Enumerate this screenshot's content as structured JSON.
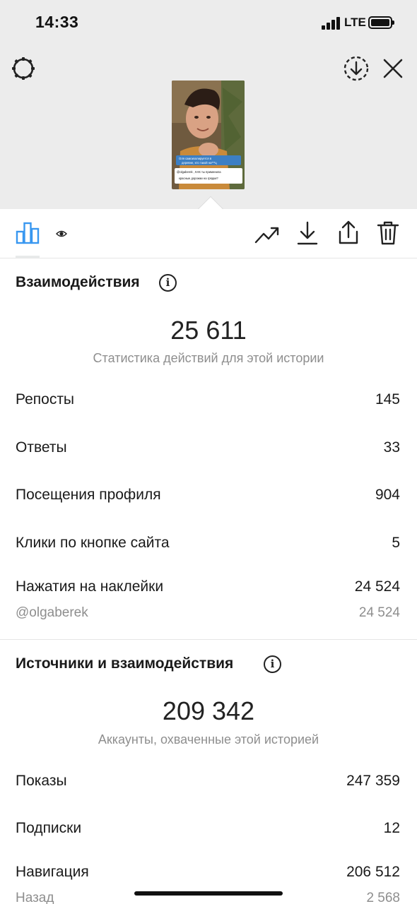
{
  "status_bar": {
    "time": "14:33",
    "network": "LTE"
  },
  "thumbnail": {
    "caption_line1": "Оля самоизолируется в деревне, кто такой на***ц",
    "caption_line2": "@olgaberek , КАК ты применила красные дорожки на грядки?"
  },
  "interactions": {
    "title": "Взаимодействия",
    "total": "25 611",
    "caption": "Статистика действий для этой истории",
    "rows": [
      {
        "label": "Репосты",
        "value": "145"
      },
      {
        "label": "Ответы",
        "value": "33"
      },
      {
        "label": "Посещения профиля",
        "value": "904"
      },
      {
        "label": "Клики по кнопке сайта",
        "value": "5"
      },
      {
        "label": "Нажатия на наклейки",
        "value": "24 524"
      }
    ],
    "sticker_sub": {
      "label": "@olgaberek",
      "value": "24 524"
    }
  },
  "discovery": {
    "title": "Источники и взаимодействия",
    "total": "209 342",
    "caption": "Аккаунты, охваченные этой историей",
    "rows": [
      {
        "label": "Показы",
        "value": "247 359"
      },
      {
        "label": "Подписки",
        "value": "12"
      },
      {
        "label": "Навигация",
        "value": "206 512"
      }
    ],
    "nav_sub": {
      "label": "Назад",
      "value": "2 568"
    }
  },
  "colors": {
    "accent": "#3897f0",
    "text": "#1a1a1a",
    "muted": "#8e8e8e"
  }
}
